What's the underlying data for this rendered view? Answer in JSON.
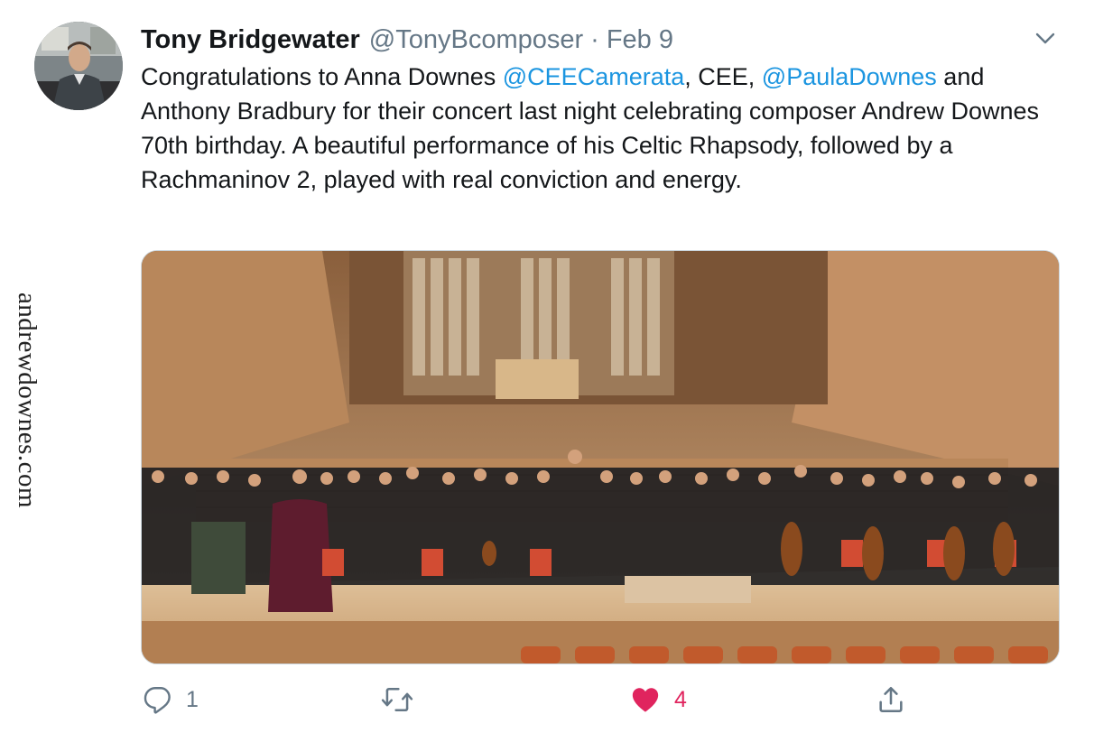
{
  "watermark": "andrewdownes.com",
  "tweet": {
    "author_name": "Tony Bridgewater",
    "handle": "@TonyBcomposer",
    "separator": "·",
    "date": "Feb 9",
    "text_parts": {
      "p1": "Congratulations to Anna Downes ",
      "m1": "@CEECamerata",
      "p2": ", CEE, ",
      "m2": "@PaulaDownes",
      "p3": " and Anthony Bradbury for their concert last night celebrating composer Andrew Downes 70th birthday. A beautiful performance of his Celtic Rhapsody, followed by a Rachmaninov 2, played with real conviction and energy."
    }
  },
  "actions": {
    "reply_count": "1",
    "retweet_count": "",
    "like_count": "4"
  },
  "colors": {
    "mention": "#1b95e0",
    "secondary_text": "#657786",
    "like": "#e0245e"
  },
  "icons": {
    "reply": "speech-bubble-icon",
    "retweet": "retweet-icon",
    "like": "heart-icon",
    "share": "share-icon",
    "menu": "chevron-down-icon"
  }
}
